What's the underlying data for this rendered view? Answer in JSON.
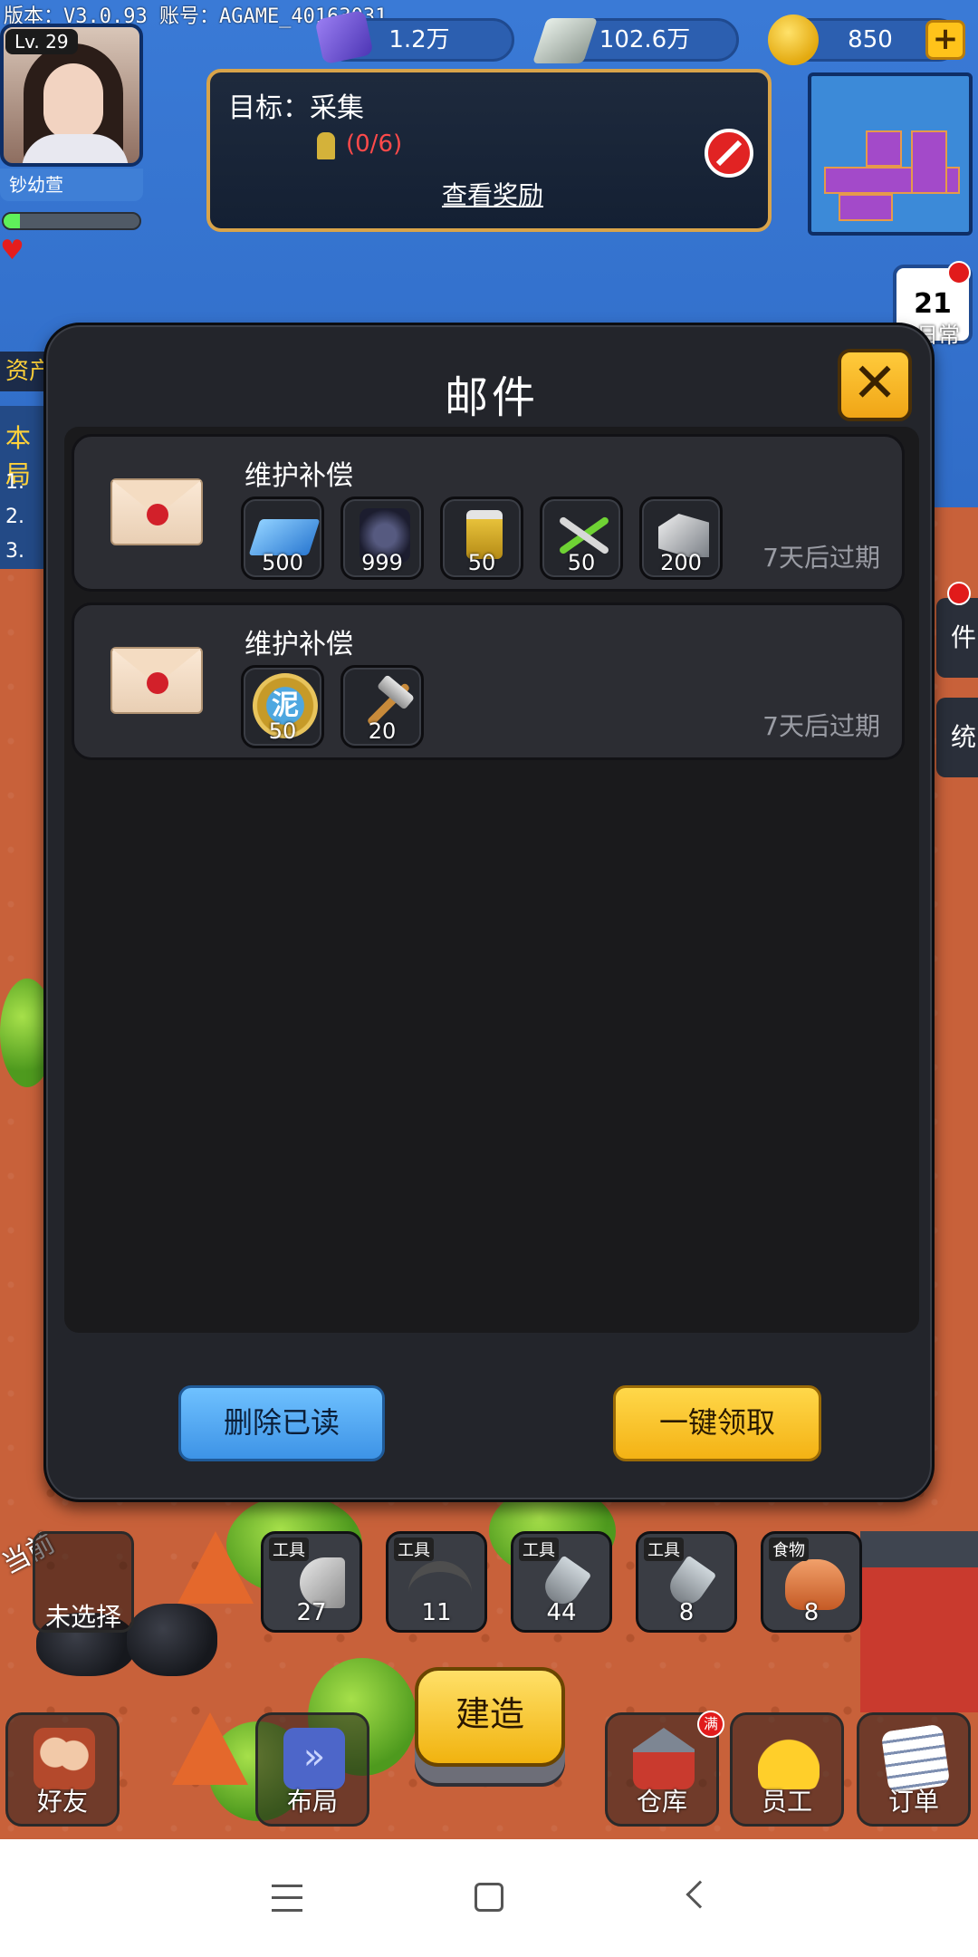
{
  "hud": {
    "version_text": "版本：V3.0.93 账号：AGAME_40163031",
    "player": {
      "level": "Lv. 29",
      "name": "钞幼萱",
      "xp_fraction": 0.12
    },
    "resources": [
      {
        "icon": "gem-book-icon",
        "value": "1.2万"
      },
      {
        "icon": "cash-stack-icon",
        "value": "102.6万"
      },
      {
        "icon": "gold-coin-icon",
        "value": "850"
      }
    ],
    "goal": {
      "title": "目标：采集",
      "progress": "(0/6)",
      "reward_link": "查看奖励"
    },
    "calendar": {
      "day": "21",
      "label": "日常"
    },
    "side_left": {
      "tab": "资产",
      "tab2": "本局",
      "rows": [
        "1.",
        "2.",
        "3."
      ]
    },
    "side_right": {
      "mail_label": "件",
      "system_label": "统"
    }
  },
  "mail_dialog": {
    "title": "邮件",
    "close_icon": "close-x-icon",
    "mails": [
      {
        "title": "维护补偿",
        "expiry": "7天后过期",
        "items": [
          {
            "icon": "glass-sheet-icon",
            "qty": "500"
          },
          {
            "icon": "pipe-bundle-icon",
            "qty": "999"
          },
          {
            "icon": "paint-jar-icon",
            "qty": "50"
          },
          {
            "icon": "pliers-icon",
            "qty": "50"
          },
          {
            "icon": "steel-beam-icon",
            "qty": "200"
          }
        ]
      },
      {
        "title": "维护补偿",
        "expiry": "7天后过期",
        "items": [
          {
            "icon": "mud-token-icon",
            "label": "泥",
            "qty": "50"
          },
          {
            "icon": "hammer-icon",
            "qty": "20"
          }
        ]
      }
    ],
    "buttons": {
      "delete_read": "删除已读",
      "claim_all": "一键领取"
    }
  },
  "bottom_bar": {
    "current_label": "当前",
    "unselected": "未选择",
    "tool_slots": [
      {
        "tag": "工具",
        "icon": "axe-icon",
        "count": "27"
      },
      {
        "tag": "工具",
        "icon": "pickaxe-icon",
        "count": "11"
      },
      {
        "tag": "工具",
        "icon": "shovel-icon",
        "count": "44"
      },
      {
        "tag": "工具",
        "icon": "shovel-icon",
        "count": "8"
      },
      {
        "tag": "食物",
        "icon": "food-icon",
        "count": "8"
      }
    ],
    "build_label": "建造",
    "nav": [
      {
        "icon": "friends-icon",
        "label": "好友"
      },
      {
        "icon": "layout-icon",
        "label": "布局"
      },
      {
        "icon": "warehouse-icon",
        "label": "仓库",
        "badge": "满"
      },
      {
        "icon": "worker-helmet-icon",
        "label": "员工"
      },
      {
        "icon": "order-list-icon",
        "label": "订单"
      }
    ]
  },
  "colors": {
    "dialog_bg": "#23252b",
    "accent_yellow": "#ffc31a",
    "accent_blue": "#3d93e6",
    "expired_text": "#9a9ca4"
  }
}
